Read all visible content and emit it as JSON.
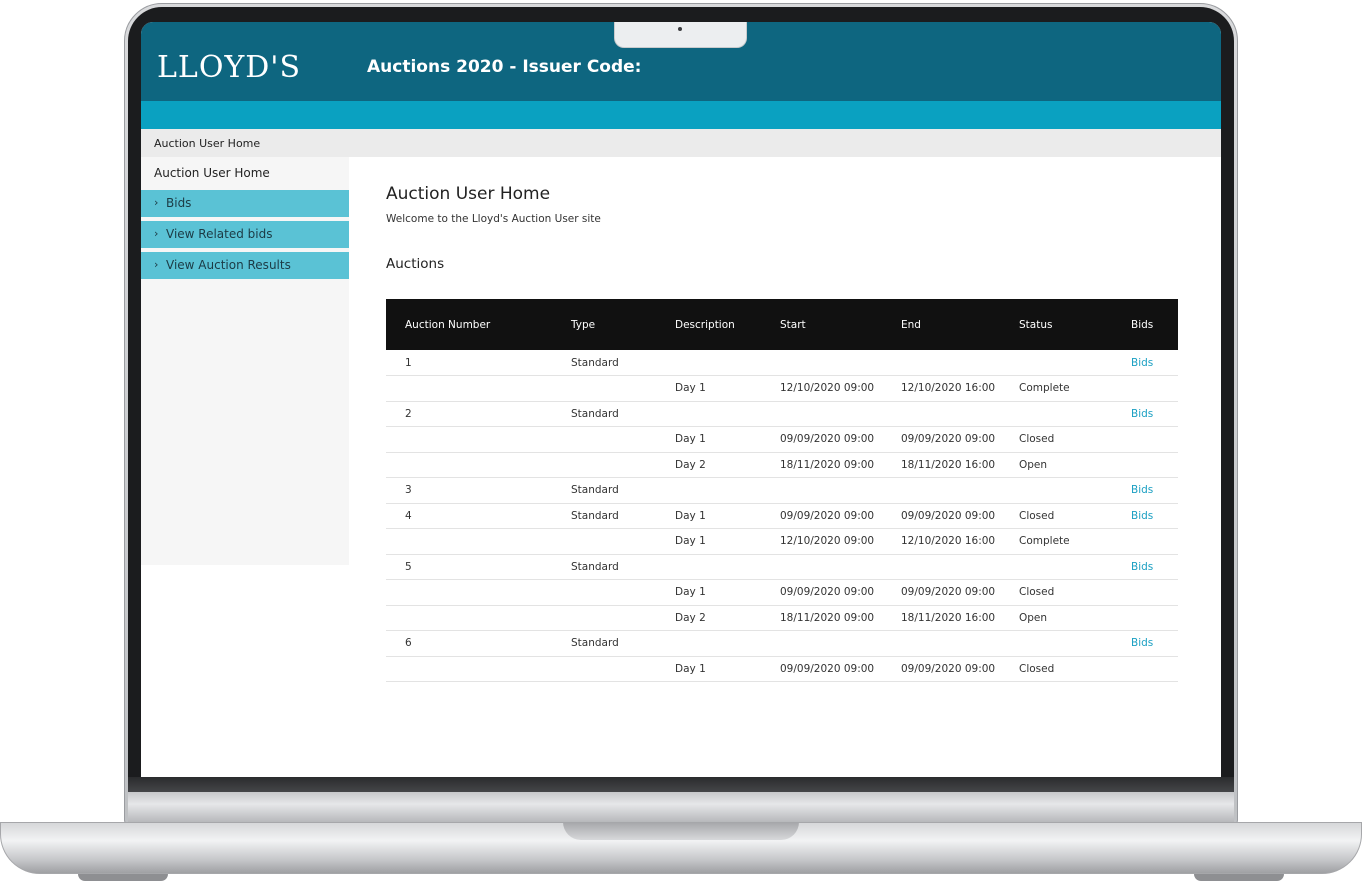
{
  "app": {
    "logo": "LLOYD'S",
    "title": "Auctions 2020 - Issuer Code:"
  },
  "breadcrumb": "Auction User Home",
  "sidebar": {
    "home": "Auction User Home",
    "items": [
      {
        "label": "Bids",
        "icon": "chevron-right-icon"
      },
      {
        "label": "View Related bids",
        "icon": "chevron-right-icon"
      },
      {
        "label": "View Auction Results",
        "icon": "chevron-right-icon"
      }
    ]
  },
  "main": {
    "title": "Auction User Home",
    "welcome": "Welcome to the Lloyd's Auction User site",
    "section": "Auctions"
  },
  "table": {
    "headers": [
      "Auction Number",
      "Type",
      "Description",
      "Start",
      "End",
      "Status",
      "Bids"
    ],
    "rows": [
      [
        "1",
        "Standard",
        "",
        "",
        "",
        "",
        "Bids"
      ],
      [
        "",
        "",
        "Day 1",
        "12/10/2020 09:00",
        "12/10/2020 16:00",
        "Complete",
        ""
      ],
      [
        "2",
        "Standard",
        "",
        "",
        "",
        "",
        "Bids"
      ],
      [
        "",
        "",
        "Day 1",
        "09/09/2020 09:00",
        "09/09/2020 09:00",
        "Closed",
        ""
      ],
      [
        "",
        "",
        "Day 2",
        "18/11/2020 09:00",
        "18/11/2020 16:00",
        "Open",
        ""
      ],
      [
        "3",
        "Standard",
        "",
        "",
        "",
        "",
        "Bids"
      ],
      [
        "4",
        "Standard",
        "Day 1",
        "09/09/2020 09:00",
        "09/09/2020 09:00",
        "Closed",
        "Bids"
      ],
      [
        "",
        "",
        "Day 1",
        "12/10/2020 09:00",
        "12/10/2020 16:00",
        "Complete",
        ""
      ],
      [
        "5",
        "Standard",
        "",
        "",
        "",
        "",
        "Bids"
      ],
      [
        "",
        "",
        "Day 1",
        "09/09/2020 09:00",
        "09/09/2020 09:00",
        "Closed",
        ""
      ],
      [
        "",
        "",
        "Day 2",
        "18/11/2020 09:00",
        "18/11/2020 16:00",
        "Open",
        ""
      ],
      [
        "6",
        "Standard",
        "",
        "",
        "",
        "",
        "Bids"
      ],
      [
        "",
        "",
        "Day 1",
        "09/09/2020 09:00",
        "09/09/2020 09:00",
        "Closed",
        ""
      ]
    ]
  },
  "colors": {
    "header_dark": "#0e6680",
    "header_accent": "#0aa1c1",
    "sidebar_item": "#5ac2d5",
    "table_header": "#111111",
    "link": "#1a9fc2"
  }
}
